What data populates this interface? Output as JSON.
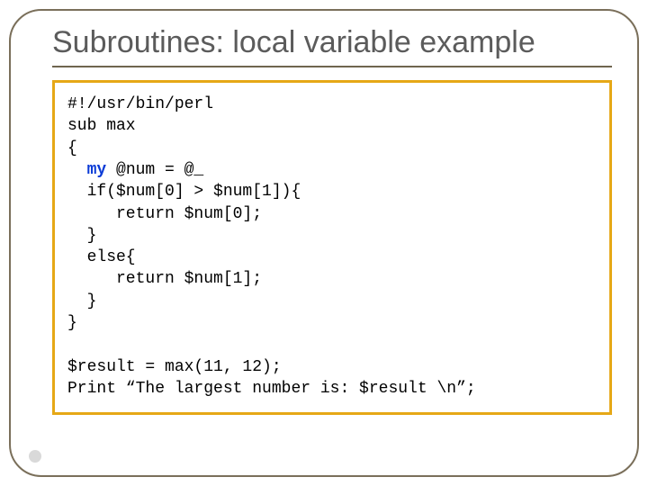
{
  "slide": {
    "title": "Subroutines: local variable example"
  },
  "code": {
    "l1": "#!/usr/bin/perl",
    "l2": "sub max",
    "l3": "{",
    "l4_pre": "  ",
    "l4_kw": "my",
    "l4_post": " @num = @_",
    "l5": "  if($num[0] > $num[1]){",
    "l6": "     return $num[0];",
    "l7": "  }",
    "l8": "  else{",
    "l9": "     return $num[1];",
    "l10": "  }",
    "l11": "}",
    "blank": "",
    "l12": "$result = max(11, 12);",
    "l13": "Print “The largest number is: $result \\n”;"
  }
}
